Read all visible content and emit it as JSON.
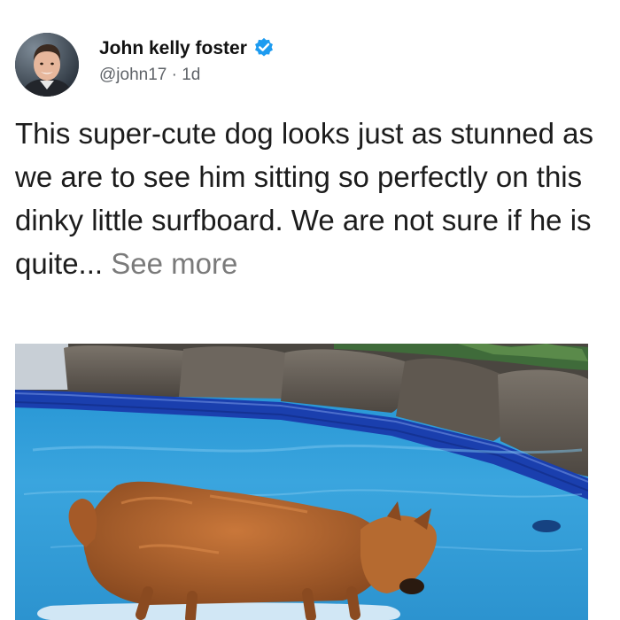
{
  "post": {
    "author_name": "John kelly foster",
    "handle": "@john17",
    "separator": "·",
    "time_ago": "1d",
    "text": "This super-cute dog looks just as stunned as we are to see him sitting so perfectly on this dinky little surfboard. We are not sure if he is quite...",
    "see_more_label": "See more",
    "verified_badge_icon": "verified-check-icon",
    "accent_color": "#1d9bf0"
  }
}
